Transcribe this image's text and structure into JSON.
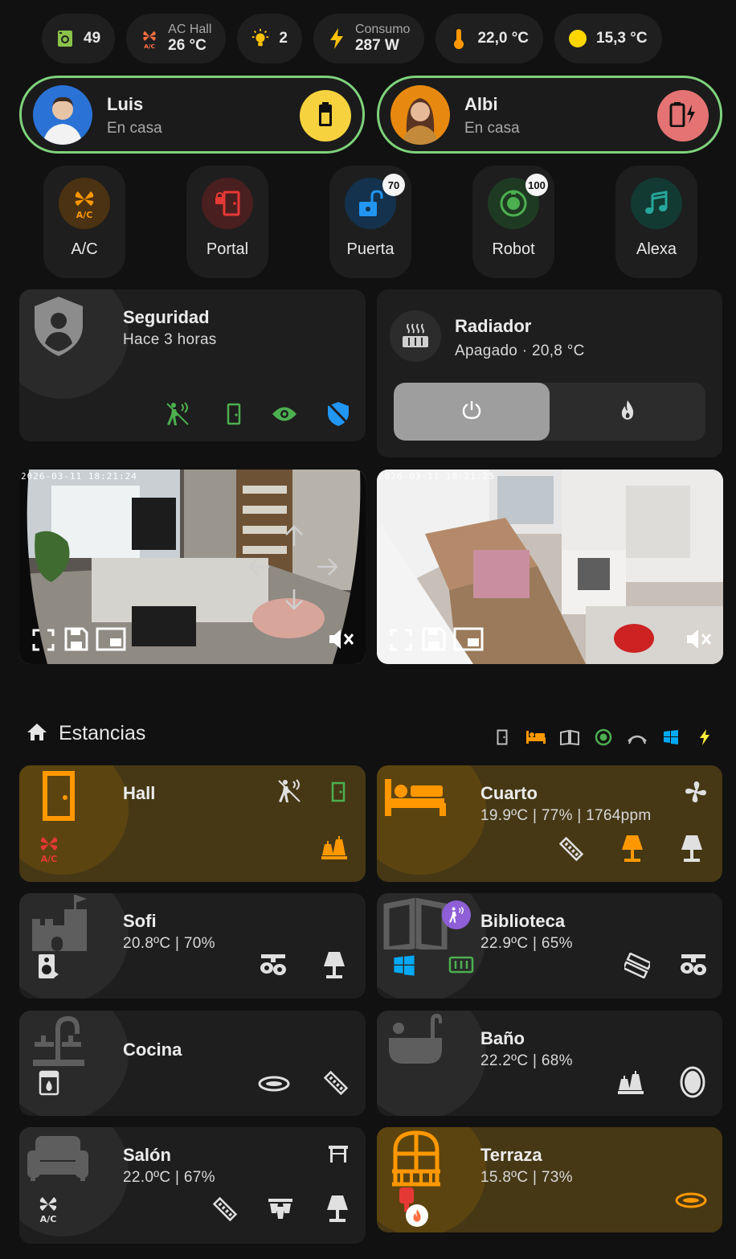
{
  "chips": {
    "washer": {
      "value": "49"
    },
    "ac": {
      "label": "AC Hall",
      "value": "26 °C"
    },
    "lights": {
      "value": "2"
    },
    "power": {
      "label": "Consumo",
      "value": "287 W"
    },
    "indoor_temp": {
      "value": "22,0 °C"
    },
    "outdoor_temp": {
      "value": "15,3 °C"
    }
  },
  "persons": [
    {
      "name": "Luis",
      "state": "En casa",
      "battery_color": "#f6d23e"
    },
    {
      "name": "Albi",
      "state": "En casa",
      "battery_color": "#e57373"
    }
  ],
  "quick": [
    {
      "label": "A/C",
      "icon": "ac-icon"
    },
    {
      "label": "Portal",
      "icon": "door-lock-icon"
    },
    {
      "label": "Puerta",
      "icon": "lock-open-icon",
      "badge": "70"
    },
    {
      "label": "Robot",
      "icon": "robot-vacuum-icon",
      "badge": "100"
    },
    {
      "label": "Alexa",
      "icon": "music-note-icon"
    }
  ],
  "security": {
    "title": "Seguridad",
    "subtitle": "Hace 3 horas"
  },
  "radiator": {
    "title": "Radiador",
    "subtitle": "Apagado · 20,8 °C",
    "mode": "off"
  },
  "cameras": [
    {
      "timestamp": "2026-03-11 18:21:24"
    },
    {
      "timestamp": "2026-03-11 18:21:25"
    }
  ],
  "section": {
    "title": "Estancias"
  },
  "rooms": {
    "hall": {
      "name": "Hall"
    },
    "cuarto": {
      "name": "Cuarto",
      "info": "19.9ºC | 77% | 1764ppm"
    },
    "sofi": {
      "name": "Sofi",
      "info": "20.8ºC | 70%"
    },
    "biblioteca": {
      "name": "Biblioteca",
      "info": "22.9ºC | 65%"
    },
    "cocina": {
      "name": "Cocina"
    },
    "bano": {
      "name": "Baño",
      "info": "22.2ºC | 68%"
    },
    "salon": {
      "name": "Salón",
      "info": "22.0ºC | 67%"
    },
    "terraza": {
      "name": "Terraza",
      "info": "15.8ºC | 73%"
    }
  },
  "colors": {
    "accent_green": "#4caf50",
    "accent_orange": "#ff9800",
    "accent_yellow": "#f6d23e",
    "accent_red": "#e57373",
    "accent_blue": "#2196f3",
    "warm_card": "#463815"
  }
}
